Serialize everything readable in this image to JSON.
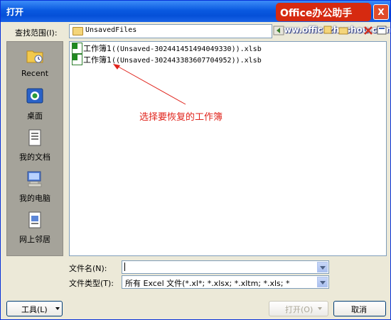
{
  "window": {
    "title": "打开",
    "close_glyph": "X",
    "brand_logo": "Office办公助手",
    "watermark": "www.officezhushou.com"
  },
  "lookin": {
    "label": "查找范围(I):",
    "value": "UnsavedFiles"
  },
  "places": [
    {
      "label": "Recent"
    },
    {
      "label": "桌面"
    },
    {
      "label": "我的文档"
    },
    {
      "label": "我的电脑"
    },
    {
      "label": "网上邻居"
    }
  ],
  "files": [
    {
      "prefix": "工作簿1",
      "suffix": "((Unsaved-302441451494049330)).xlsb"
    },
    {
      "prefix": "工作簿1",
      "suffix": "((Unsaved-302443383607704952)).xlsb"
    }
  ],
  "annotation": {
    "text": "选择要恢复的工作簿",
    "color": "#e0231b"
  },
  "filename": {
    "label": "文件名(N):",
    "value": ""
  },
  "filetype": {
    "label": "文件类型(T):",
    "value": "所有 Excel 文件(*.xl*; *.xlsx; *.xltm; *.xls; *"
  },
  "buttons": {
    "tools": "工具(L)",
    "open": "打开(O)",
    "cancel": "取消"
  }
}
